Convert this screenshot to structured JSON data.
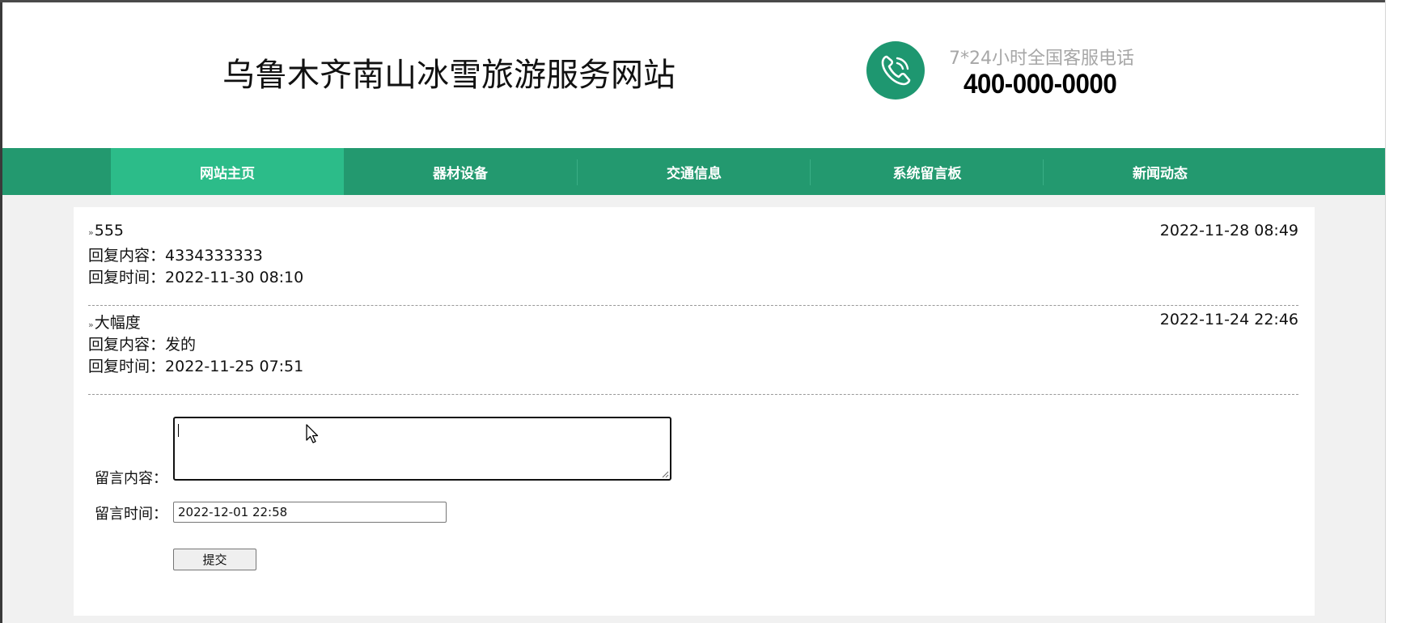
{
  "header": {
    "site_title": "乌鲁木齐南山冰雪旅游服务网站",
    "hotline_label": "7*24小时全国客服电话",
    "hotline_number": "400-000-0000",
    "phone_icon": "phone-icon",
    "accent_color": "#1e9770"
  },
  "nav": {
    "items": [
      {
        "label": "网站主页",
        "active": true
      },
      {
        "label": "器材设备",
        "active": false
      },
      {
        "label": "交通信息",
        "active": false
      },
      {
        "label": "系统留言板",
        "active": false
      },
      {
        "label": "新闻动态",
        "active": false
      }
    ],
    "bg_color": "#23996f",
    "active_color": "#2cbc89"
  },
  "messages": [
    {
      "bullet": "»",
      "title": "555",
      "date": "2022-11-28 08:49",
      "reply_label": "回复内容：",
      "reply_content": "4334333333",
      "reply_time_label": "回复时间：",
      "reply_time": "2022-11-30 08:10"
    },
    {
      "bullet": "»",
      "title": "大幅度",
      "date": "2022-11-24 22:46",
      "reply_label": "回复内容：",
      "reply_content": "发的",
      "reply_time_label": "回复时间：",
      "reply_time": "2022-11-25 07:51"
    }
  ],
  "form": {
    "content_label": "留言内容：",
    "content_value": "",
    "time_label": "留言时间：",
    "time_value": "2022-12-01 22:58",
    "submit_label": "提交"
  }
}
